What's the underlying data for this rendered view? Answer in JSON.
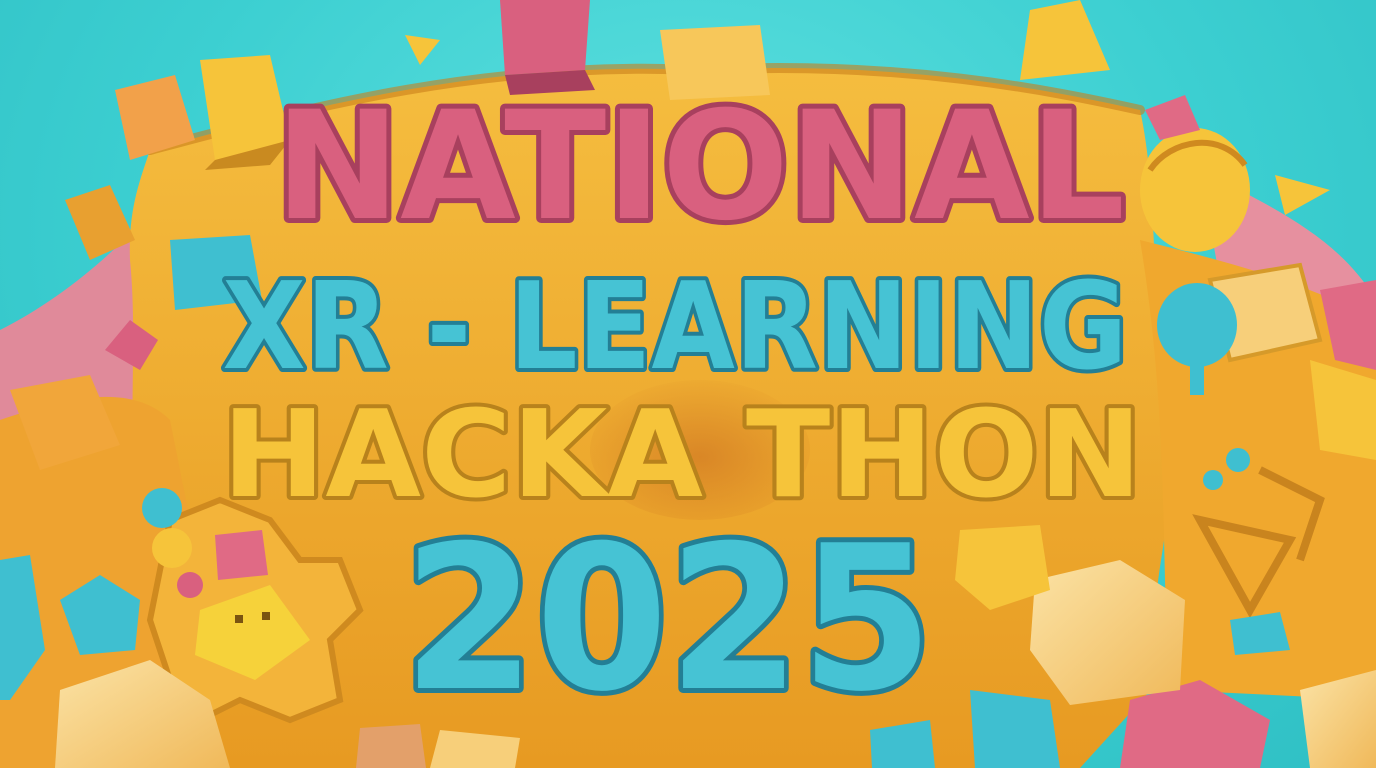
{
  "poster": {
    "line1": "NATIONAL",
    "line2": "XR - LEARNING",
    "line3": "HACKA THON",
    "line4": "2025"
  },
  "colors": {
    "background": "#3fd0d2",
    "base": "#f2b233",
    "base_dark": "#d9921f",
    "pink": "#d9607f",
    "pink_dark": "#a8405e",
    "cyan": "#3fbfd0",
    "cyan_dark": "#237f95",
    "yellow": "#f6c43a",
    "yellow_dark": "#b8821c",
    "peach": "#f7cf7a"
  }
}
